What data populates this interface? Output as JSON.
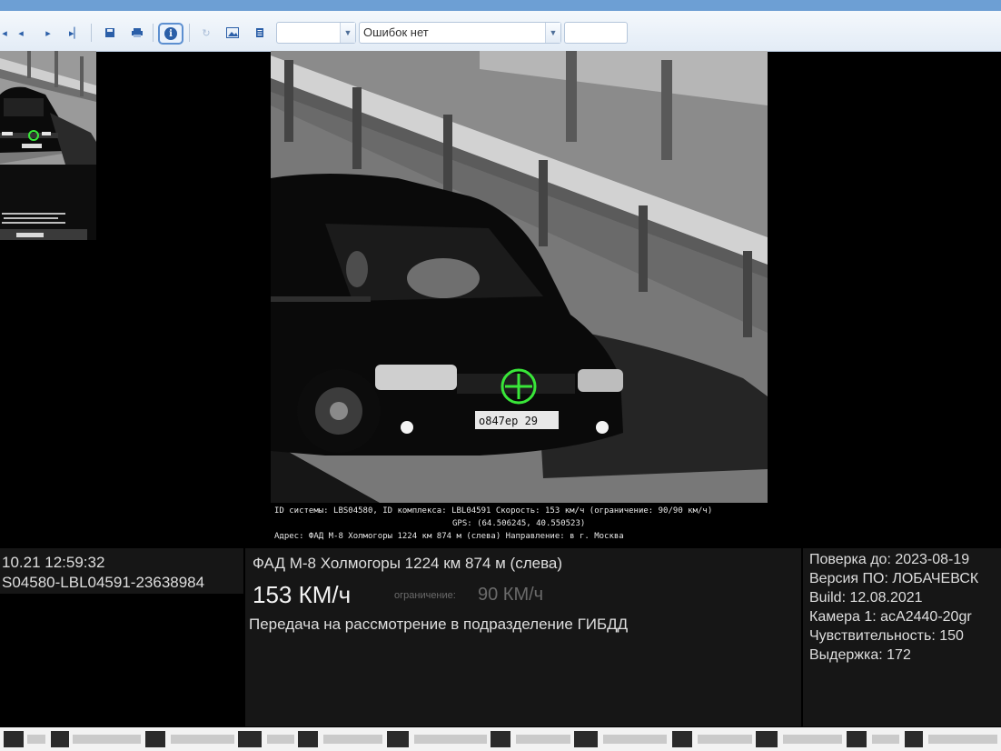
{
  "toolbar": {
    "combo_empty_value": "",
    "errors_combo_value": "Ошибок нет",
    "extra_field_value": ""
  },
  "photo_caption": {
    "line1": "ID системы: LBS04580, ID комплекса: LBL04591  Скорость: 153 км/ч (ограничение: 90/90 км/ч)",
    "line2": "GPS: (64.506245, 40.550523)",
    "line3": "Адрес: ФАД М-8 Холмогоры 1224 км 874 м (слева)  Направление: в г. Москва"
  },
  "plate_text": "о847ер 29",
  "left_panel": {
    "datetime": "10.21 12:59:32",
    "violation_id": "S04580-LBL04591-23638984"
  },
  "center_panel": {
    "address": "ФАД М-8 Холмогоры 1224 км 874 м (слева)",
    "speed": "153 КМ/ч",
    "limit_label": "ограничение:",
    "limit_value": "90 КМ/ч",
    "status": "Передача на рассмотрение в подразделение ГИБДД"
  },
  "right_panel": {
    "verification": "Поверка до: 2023-08-19",
    "software_version": "Версия ПО: ЛОБАЧЕВСК",
    "build": "Build: 12.08.2021",
    "camera": "Камера 1: acA2440-20gr",
    "sensitivity": "Чувствительность: 150",
    "exposure": "Выдержка: 172"
  },
  "colors": {
    "toolbar_icon": "#2b5fa8",
    "target_marker": "#39e639",
    "panel_bg": "#161616",
    "limit_text": "#6a6a6a"
  }
}
